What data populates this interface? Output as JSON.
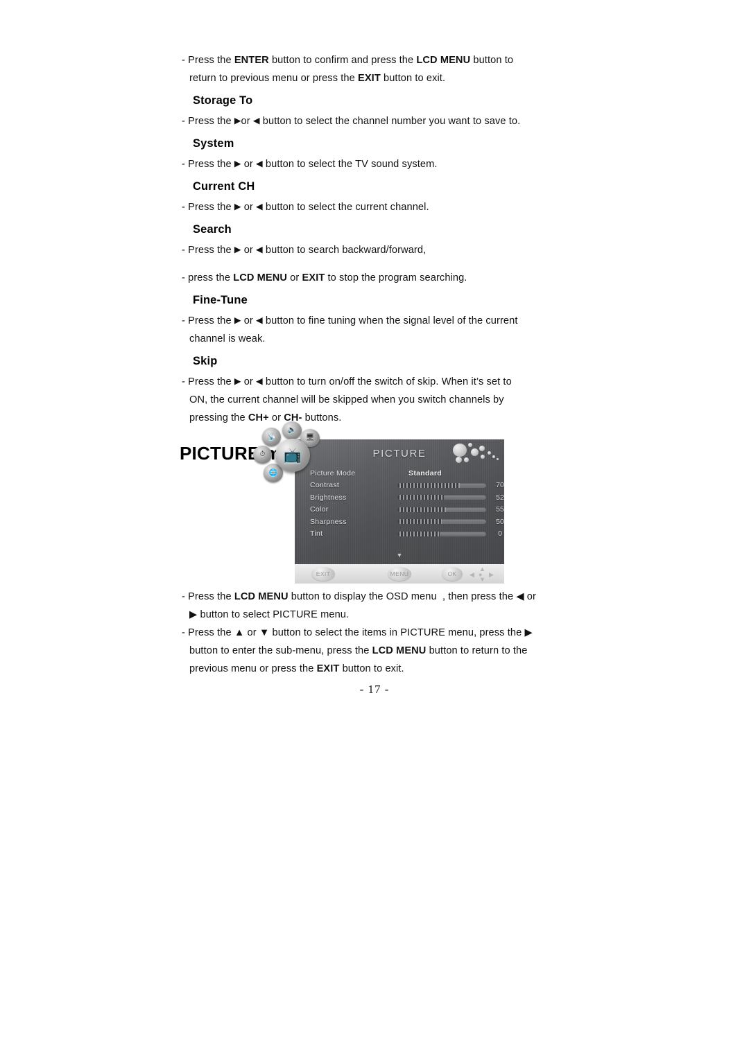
{
  "doc": {
    "page_number": "- 17 -"
  },
  "top_section": {
    "intro": {
      "line1_pre": "- Press the ",
      "line1_b1": "ENTER",
      "line1_mid": " button to confirm and press the ",
      "line1_b2": "LCD MENU",
      "line1_post": " button to",
      "line2_pre": "return to previous menu or press the ",
      "line2_b1": "EXIT",
      "line2_post": " button to exit."
    },
    "items": [
      {
        "heading": "Storage To",
        "lines": [
          {
            "pre": "- Press the ",
            "arrow1": "▶",
            "mid": "or ",
            "arrow2": "◀",
            "post": " button to select the channel number you want to save to."
          }
        ]
      },
      {
        "heading": "System",
        "lines": [
          {
            "pre": "- Press the ",
            "arrow1": "▶",
            "mid": " or ",
            "arrow2": "◀",
            "post": " button to select the TV sound system."
          }
        ]
      },
      {
        "heading": "Current CH",
        "lines": [
          {
            "pre": "- Press the ",
            "arrow1": "▶",
            "mid": " or ",
            "arrow2": "◀",
            "post": " button to select the current channel."
          }
        ]
      },
      {
        "heading": "Search",
        "lines": [
          {
            "pre": "- Press the ",
            "arrow1": "▶",
            "mid": " or ",
            "arrow2": "◀",
            "post": " button to search backward/forward,"
          }
        ],
        "extra_line": {
          "pre": "- press the ",
          "b1": "LCD MENU",
          "mid": " or ",
          "b2": "EXIT",
          "post": " to stop the program searching."
        }
      },
      {
        "heading": "Fine-Tune",
        "lines": [
          {
            "pre": "- Press the ",
            "arrow1": "▶",
            "mid": " or ",
            "arrow2": "◀",
            "post": " button to fine tuning when the signal level of the current"
          }
        ],
        "cont_line": "channel is weak."
      },
      {
        "heading": "Skip",
        "lines": [
          {
            "pre": "- Press the ",
            "arrow1": "▶",
            "mid": " or ",
            "arrow2": "◀",
            "post": " button to turn on/off the switch of skip. When it’s set to"
          }
        ],
        "cont_line": "ON, the current channel will be skipped when you switch channels by",
        "cont_line2_pre": "pressing the ",
        "cont_line2_b1": "CH+",
        "cont_line2_mid": " or ",
        "cont_line2_b2": "CH-",
        "cont_line2_post": " buttons."
      }
    ]
  },
  "picture_section": {
    "title": "PICTURE menu"
  },
  "osd": {
    "title": "PICTURE",
    "down_arrow": "▼",
    "icons": [
      {
        "name": "antenna-icon",
        "glyph": "📡"
      },
      {
        "name": "sound-icon",
        "glyph": "🔊"
      },
      {
        "name": "setup-icon",
        "glyph": "🖥"
      },
      {
        "name": "clock-icon",
        "glyph": "⏱"
      },
      {
        "name": "globe-icon",
        "glyph": "🌐"
      },
      {
        "name": "picture-icon",
        "glyph": "📺"
      }
    ],
    "rows": [
      {
        "label": "Picture Mode",
        "value": "Standard",
        "type": "mode"
      },
      {
        "label": "Contrast",
        "value": "70",
        "percent": 70,
        "type": "slider"
      },
      {
        "label": "Brightness",
        "value": "52",
        "percent": 52,
        "type": "slider"
      },
      {
        "label": "Color",
        "value": "55",
        "percent": 55,
        "type": "slider"
      },
      {
        "label": "Sharpness",
        "value": "50",
        "percent": 50,
        "type": "slider"
      },
      {
        "label": "Tint",
        "value": "0",
        "percent": 48,
        "type": "slider"
      }
    ],
    "toolbar": {
      "exit_label": "EXIT",
      "menu_label": "MENU",
      "ok_label": "OK",
      "dpad": {
        "up": "▲",
        "down": "▼",
        "left": "◀",
        "right": "▶",
        "mid": "●"
      }
    }
  },
  "bottom_section": {
    "para1": {
      "line1_pre": "- Press the ",
      "line1_b1": "LCD MENU",
      "line1_post": " button to display the OSD menu  , then press the ◀ or",
      "line2": "▶ button to select PICTURE menu."
    },
    "para2": {
      "line1": "- Press the ▲ or ▼ button to select the items in PICTURE menu, press the ▶",
      "line2_pre": "button to enter the sub-menu, press the ",
      "line2_b1": "LCD MENU",
      "line2_post": " button to return to the",
      "line3_pre": "previous menu or press the ",
      "line3_b1": "EXIT",
      "line3_post": " button to exit."
    }
  }
}
